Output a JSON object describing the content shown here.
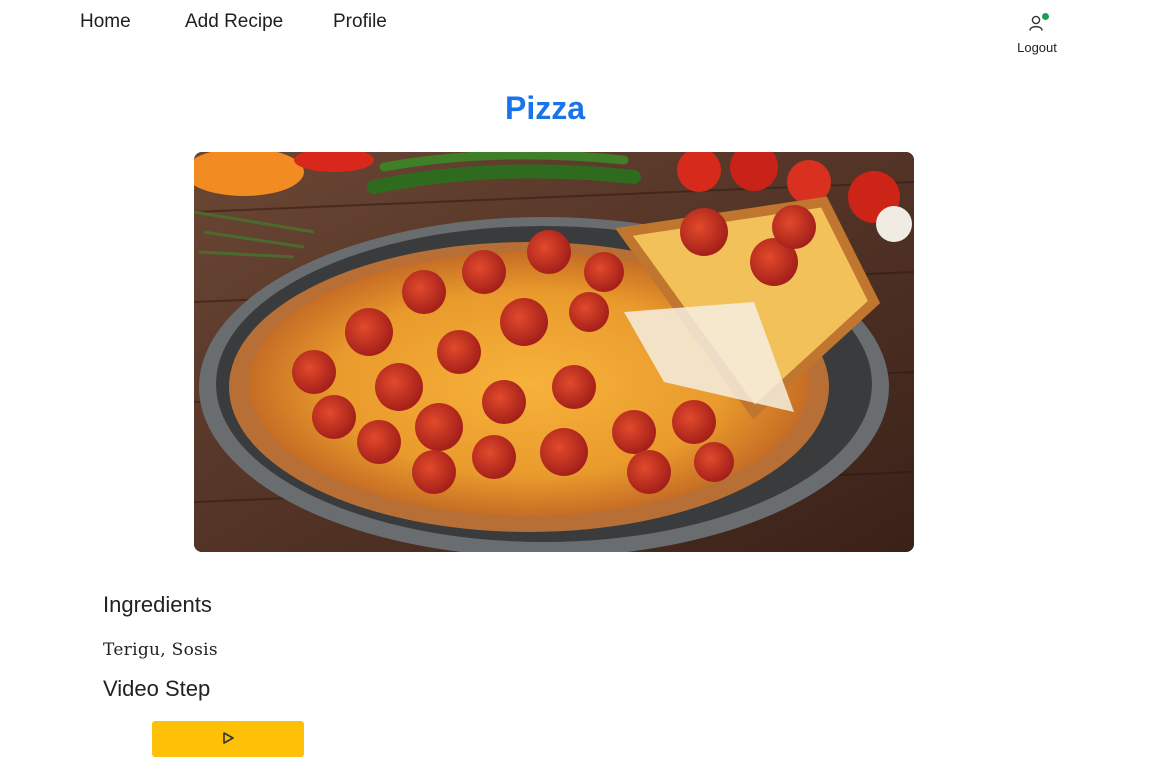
{
  "nav": {
    "links": [
      {
        "label": "Home"
      },
      {
        "label": "Add Recipe"
      },
      {
        "label": "Profile"
      }
    ],
    "user": {
      "icon": "user-icon",
      "status_color": "#1aa052",
      "logout_label": "Logout"
    }
  },
  "recipe": {
    "title": "Pizza",
    "title_color": "#1a73e8",
    "image_alt": "pizza-photo",
    "ingredients_heading": "Ingredients",
    "ingredients": "Terigu, Sosis",
    "video_heading": "Video Step",
    "play_button_icon": "play-icon",
    "play_button_color": "#ffc107"
  }
}
